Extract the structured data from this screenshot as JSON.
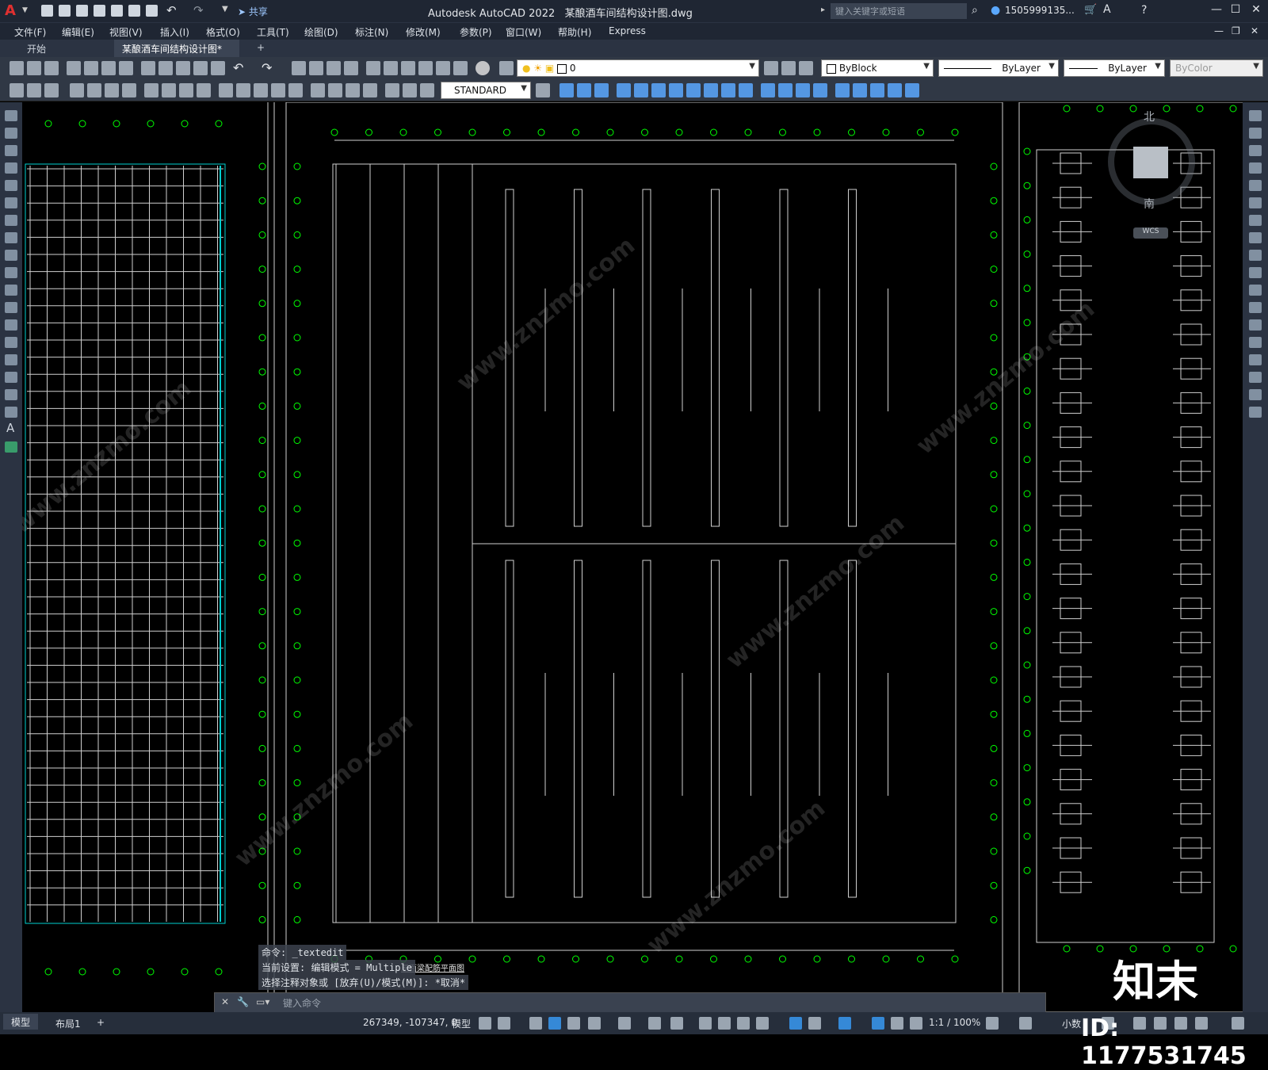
{
  "title_bar": {
    "app_title": "Autodesk AutoCAD 2022",
    "file_name": "某酿酒车间结构设计图.dwg",
    "share_label": "共享",
    "search_placeholder": "键入关键字或短语",
    "user_name": "1505999135..."
  },
  "menu": [
    "文件(F)",
    "编辑(E)",
    "视图(V)",
    "插入(I)",
    "格式(O)",
    "工具(T)",
    "绘图(D)",
    "标注(N)",
    "修改(M)",
    "参数(P)",
    "窗口(W)",
    "帮助(H)",
    "Express"
  ],
  "tabs": [
    {
      "label": "开始"
    },
    {
      "label": "某酿酒车间结构设计图*"
    }
  ],
  "toolbar": {
    "layer_value": "0",
    "color_value": "ByBlock",
    "linetype_value": "ByLayer",
    "lineweight_value": "ByLayer",
    "plotstyle_value": "ByColor",
    "textstyle_value": "STANDARD"
  },
  "viewcube": {
    "north": "北",
    "south": "南",
    "wcs": "WCS"
  },
  "command": {
    "history": [
      "命令: _textedit",
      "当前设置: 编辑模式 = Multiple",
      "选择注释对象或 [放弃(U)/模式(M)]: *取消*"
    ],
    "placeholder": "键入命令"
  },
  "layout_tabs": [
    "模型",
    "布局1"
  ],
  "status": {
    "coords": "267349, -107347, 0",
    "space": "模型",
    "scale": "1:1 / 100%",
    "units": "小数"
  },
  "watermark": {
    "site": "www.znzmo.com",
    "brand": "知末",
    "id": "ID: 1177531745"
  },
  "drawing": {
    "center_title": "屋面梁配筋平面图"
  },
  "colors": {
    "chrome": "#1f2633",
    "axis_bubble": "#00ff00",
    "accent": "#3aa0ff",
    "cyan": "#00d0d0"
  }
}
